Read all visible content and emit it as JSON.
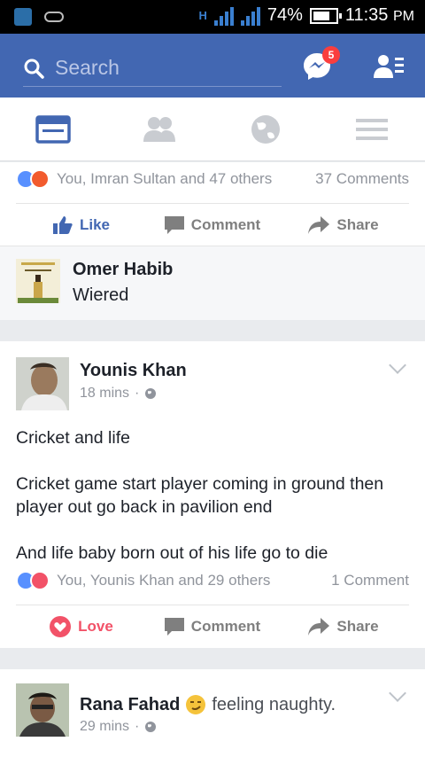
{
  "status_bar": {
    "battery": "74%",
    "time": "11:35",
    "ampm": "PM",
    "network": "H",
    "battery_level": 0.74
  },
  "header": {
    "search_placeholder": "Search",
    "messenger_badge": "5"
  },
  "tabs": [
    "news-feed-icon",
    "friends-icon",
    "globe-icon",
    "menu-icon"
  ],
  "post1": {
    "reactions_text": "You, Imran Sultan and 47 others",
    "comments": "37 Comments",
    "actions": {
      "like": "Like",
      "comment": "Comment",
      "share": "Share"
    },
    "top_comment": {
      "name": "Omer Habib",
      "text": "Wiered"
    }
  },
  "post2": {
    "author": "Younis Khan",
    "time": "18 mins",
    "dot": "·",
    "paragraphs": [
      "Cricket and life",
      "Cricket game start player coming in ground then player out go back in pavilion end",
      "And life baby born out of his life go to die"
    ],
    "reactions_text": "You, Younis Khan and 29 others",
    "comments": "1 Comment",
    "actions": {
      "love": "Love",
      "comment": "Comment",
      "share": "Share"
    }
  },
  "post3": {
    "author": "Rana Fahad",
    "feeling": "feeling naughty.",
    "time": "29 mins",
    "dot": "·"
  }
}
